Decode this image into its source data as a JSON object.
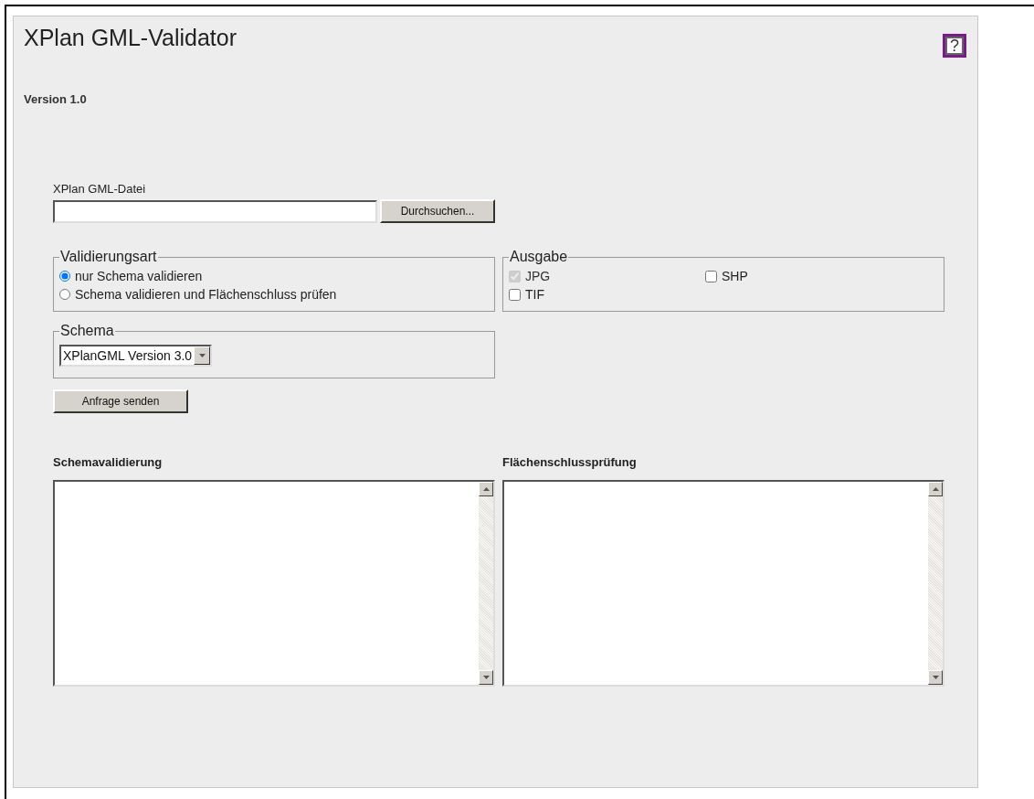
{
  "title": "XPlan GML-Validator",
  "help": {
    "label": "?"
  },
  "version": "Version 1.0",
  "file": {
    "label": "XPlan GML-Datei",
    "button": "Durchsuchen..."
  },
  "validation_type": {
    "legend": "Validierungsart",
    "options": [
      {
        "label": "nur Schema validieren",
        "selected": true
      },
      {
        "label": "Schema validieren und Flächenschluss prüfen",
        "selected": false
      }
    ]
  },
  "output": {
    "legend": "Ausgabe",
    "options": [
      {
        "label": "JPG",
        "checked": true,
        "disabled": true
      },
      {
        "label": "SHP",
        "checked": false,
        "disabled": false
      },
      {
        "label": "TIF",
        "checked": false,
        "disabled": false
      }
    ]
  },
  "schema": {
    "legend": "Schema",
    "value": "XPlanGML Version 3.0"
  },
  "submit": "Anfrage senden",
  "results": [
    {
      "heading": "Schemavalidierung"
    },
    {
      "heading": "Flächenschlussprüfung"
    }
  ]
}
